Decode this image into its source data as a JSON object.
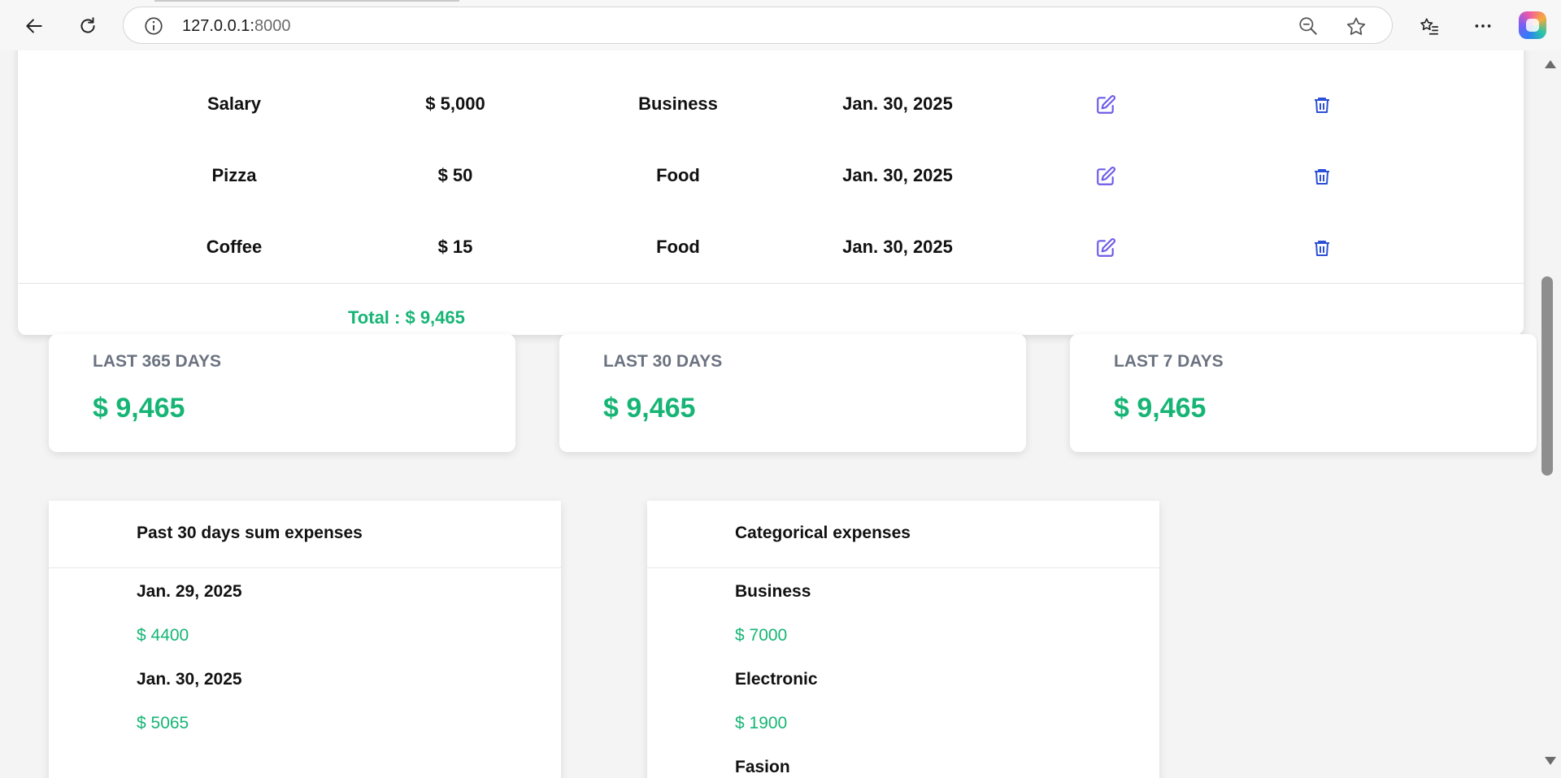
{
  "browser": {
    "url_host": "127.0.0.1:",
    "url_port": "8000",
    "accent": "#17b575"
  },
  "transactions": {
    "rows": [
      {
        "name": "Salary",
        "amount": "$ 5,000",
        "category": "Business",
        "date": "Jan. 30, 2025"
      },
      {
        "name": "Pizza",
        "amount": "$ 50",
        "category": "Food",
        "date": "Jan. 30, 2025"
      },
      {
        "name": "Coffee",
        "amount": "$ 15",
        "category": "Food",
        "date": "Jan. 30, 2025"
      }
    ],
    "total": "Total : $ 9,465",
    "edit_icon": "edit-icon",
    "delete_icon": "trash-icon",
    "edit_color": "#6d5ce8",
    "delete_color": "#2c4fd6"
  },
  "summaries": [
    {
      "label": "LAST 365 DAYS",
      "value": "$ 9,465"
    },
    {
      "label": "LAST 30 DAYS",
      "value": "$ 9,465"
    },
    {
      "label": "LAST 7 DAYS",
      "value": "$ 9,465"
    }
  ],
  "past30": {
    "title": "Past 30 days sum expenses",
    "items": [
      {
        "label": "Jan. 29, 2025",
        "value": "$ 4400"
      },
      {
        "label": "Jan. 30, 2025",
        "value": "$ 5065"
      }
    ]
  },
  "categorical": {
    "title": "Categorical expenses",
    "items": [
      {
        "label": "Business",
        "value": "$ 7000"
      },
      {
        "label": "Electronic",
        "value": "$ 1900"
      },
      {
        "label": "Fasion",
        "value": ""
      }
    ]
  }
}
